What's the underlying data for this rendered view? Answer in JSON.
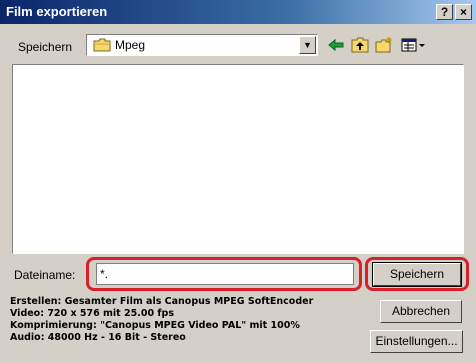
{
  "window": {
    "title": "Film exportieren",
    "help_label": "?",
    "close_label": "×"
  },
  "save_in": {
    "label": "Speichern",
    "folder": "Mpeg",
    "folder_icon": "folder-icon"
  },
  "toolbar": {
    "icons": [
      "back-arrow-icon",
      "up-folder-icon",
      "new-folder-icon",
      "view-menu-icon"
    ]
  },
  "filename": {
    "label": "Dateiname:",
    "value": "*."
  },
  "buttons": {
    "save": "Speichern",
    "cancel": "Abbrechen",
    "settings": "Einstellungen..."
  },
  "info": {
    "line1": "Erstellen: Gesamter Film als Canopus MPEG SoftEncoder",
    "line2": "Video: 720 x 576 mit 25.00 fps",
    "line3": "Komprimierung: \"Canopus MPEG Video PAL\" mit 100%",
    "line4": "Audio: 48000 Hz - 16 Bit - Stereo"
  },
  "colors": {
    "highlight": "#d81f2a",
    "titlebar": "#0a246a"
  }
}
